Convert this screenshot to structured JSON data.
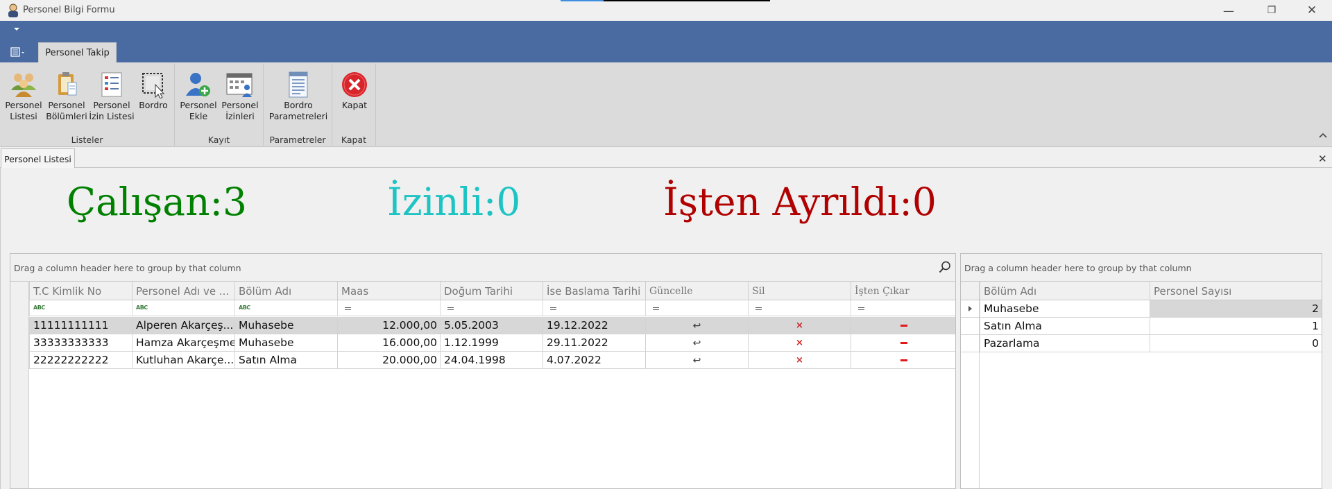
{
  "window": {
    "title": "Personel Bilgi Formu",
    "minimize_glyph": "—",
    "restore_glyph": "❐",
    "close_glyph": "✕"
  },
  "ribbon": {
    "tab": "Personel Takip",
    "groups": [
      {
        "label": "Listeler",
        "buttons": [
          {
            "line1": "Personel",
            "line2": "Listesi",
            "icon": "people-group-icon"
          },
          {
            "line1": "Personel",
            "line2": "Bölümleri",
            "icon": "clipboard-icon"
          },
          {
            "line1": "Personel",
            "line2": "İzin Listesi",
            "icon": "list-icon"
          },
          {
            "line1": "Bordro",
            "line2": "",
            "icon": "selection-cursor-icon"
          }
        ]
      },
      {
        "label": "Kayıt",
        "buttons": [
          {
            "line1": "Personel",
            "line2": "Ekle",
            "icon": "add-user-icon"
          },
          {
            "line1": "Personel",
            "line2": "İzinleri",
            "icon": "calendar-user-icon"
          }
        ]
      },
      {
        "label": "Parametreler",
        "buttons": [
          {
            "line1": "Bordro",
            "line2": "Parametreleri",
            "icon": "document-icon"
          }
        ]
      },
      {
        "label": "Kapat",
        "buttons": [
          {
            "line1": "Kapat",
            "line2": "",
            "icon": "close-circle-icon"
          }
        ]
      }
    ]
  },
  "doc_tab": {
    "label": "Personel Listesi",
    "close_glyph": "✕"
  },
  "stats": {
    "employees": "Çalışan:3",
    "on_leave": "İzinli:0",
    "left": "İşten Ayrıldı:0",
    "colors": {
      "employees": "#008000",
      "on_leave": "#1ec4c4",
      "left": "#b00000"
    }
  },
  "personnel_grid": {
    "group_panel": "Drag a column header here to group by that column",
    "columns": [
      "T.C Kimlik No",
      "Personel Adı ve ...",
      "Bölüm Adı",
      "Maas",
      "Doğum Tarihi",
      "İse Baslama Tarihi",
      "Güncelle",
      "Sil",
      "İşten Çıkar"
    ],
    "rows": [
      {
        "tc": "11111111111",
        "name": "Alperen Akarçeş...",
        "dept": "Muhasebe",
        "salary": "12.000,00",
        "birth": "5.05.2003",
        "start": "19.12.2022"
      },
      {
        "tc": "33333333333",
        "name": "Hamza Akarçeşme",
        "dept": "Muhasebe",
        "salary": "16.000,00",
        "birth": "1.12.1999",
        "start": "29.11.2022"
      },
      {
        "tc": "22222222222",
        "name": "Kutluhan Akarçe...",
        "dept": "Satın Alma",
        "salary": "20.000,00",
        "birth": "24.04.1998",
        "start": "4.07.2022"
      }
    ],
    "action_glyphs": {
      "update": "↩",
      "delete": "×"
    }
  },
  "dept_grid": {
    "group_panel": "Drag a column header here to group by that column",
    "columns": [
      "Bölüm Adı",
      "Personel Sayısı"
    ],
    "rows": [
      {
        "name": "Muhasebe",
        "count": "2"
      },
      {
        "name": "Satın Alma",
        "count": "1"
      },
      {
        "name": "Pazarlama",
        "count": "0"
      }
    ]
  }
}
